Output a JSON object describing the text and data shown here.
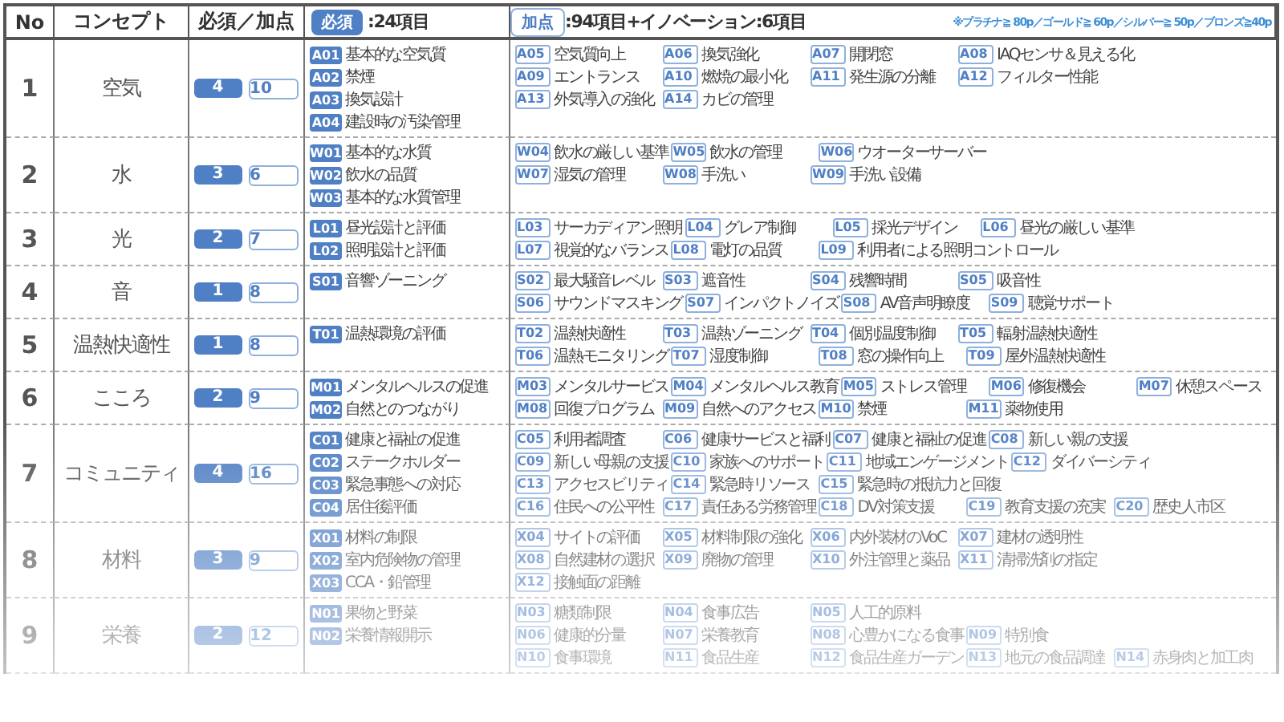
{
  "columns": [
    "No",
    "コンセプト",
    "必須／加点"
  ],
  "required_header": {
    "badge": "必須",
    "text": ":24項目"
  },
  "bonus_header": {
    "badge": "加点",
    "text": ":94項目+イノベーション:6項目",
    "note": "※プラチナ≧ 80p／ゴールド≧ 60p／シルバー≧ 50p／ブロンズ≧40p"
  },
  "rows": [
    {
      "no": "1",
      "concept": "空気",
      "required_count": "4",
      "bonus_count": "10",
      "required": [
        {
          "code": "A01",
          "label": "基本的な空気質"
        },
        {
          "code": "A02",
          "label": "禁煙"
        },
        {
          "code": "A03",
          "label": "換気設計"
        },
        {
          "code": "A04",
          "label": "建設時の汚染管理"
        }
      ],
      "bonus": [
        [
          {
            "code": "A05",
            "label": "空気質向上"
          },
          {
            "code": "A06",
            "label": "換気強化"
          },
          {
            "code": "A07",
            "label": "開閉窓"
          },
          {
            "code": "A08",
            "label": "IAQセンサ＆見える化"
          }
        ],
        [
          {
            "code": "A09",
            "label": "エントランス"
          },
          {
            "code": "A10",
            "label": "燃焼の最小化"
          },
          {
            "code": "A11",
            "label": "発生源の分離"
          },
          {
            "code": "A12",
            "label": "フィルター性能"
          }
        ],
        [
          {
            "code": "A13",
            "label": "外気導入の強化"
          },
          {
            "code": "A14",
            "label": "カビの管理"
          }
        ]
      ]
    },
    {
      "no": "2",
      "concept": "水",
      "required_count": "3",
      "bonus_count": "6",
      "required": [
        {
          "code": "W01",
          "label": "基本的な水質"
        },
        {
          "code": "W02",
          "label": "飲水の品質"
        },
        {
          "code": "W03",
          "label": "基本的な水質管理"
        }
      ],
      "bonus": [
        [
          {
            "code": "W04",
            "label": "飲水の厳しい基準"
          },
          {
            "code": "W05",
            "label": "飲水の管理"
          },
          {
            "code": "W06",
            "label": "ウオーターサーバー"
          }
        ],
        [
          {
            "code": "W07",
            "label": "湿気の管理"
          },
          {
            "code": "W08",
            "label": "手洗い"
          },
          {
            "code": "W09",
            "label": "手洗い設備"
          }
        ]
      ]
    },
    {
      "no": "3",
      "concept": "光",
      "required_count": "2",
      "bonus_count": "7",
      "required": [
        {
          "code": "L01",
          "label": "昼光設計と評価"
        },
        {
          "code": "L02",
          "label": "照明設計と評価"
        }
      ],
      "bonus": [
        [
          {
            "code": "L03",
            "label": "サーカディアン照明"
          },
          {
            "code": "L04",
            "label": "グレア制御"
          },
          {
            "code": "L05",
            "label": "採光デザイン"
          },
          {
            "code": "L06",
            "label": "昼光の厳しい基準"
          }
        ],
        [
          {
            "code": "L07",
            "label": "視覚的なバランス"
          },
          {
            "code": "L08",
            "label": "電灯の品質"
          },
          {
            "code": "L09",
            "label": "利用者による照明コントロール"
          }
        ]
      ]
    },
    {
      "no": "4",
      "concept": "音",
      "required_count": "1",
      "bonus_count": "8",
      "required": [
        {
          "code": "S01",
          "label": "音響ゾーニング"
        }
      ],
      "bonus": [
        [
          {
            "code": "S02",
            "label": "最大騒音レベル"
          },
          {
            "code": "S03",
            "label": "遮音性"
          },
          {
            "code": "S04",
            "label": "残響時間"
          },
          {
            "code": "S05",
            "label": "吸音性"
          }
        ],
        [
          {
            "code": "S06",
            "label": "サウンドマスキング"
          },
          {
            "code": "S07",
            "label": "インパクトノイズ"
          },
          {
            "code": "S08",
            "label": "AV音声明瞭度"
          },
          {
            "code": "S09",
            "label": "聴覚サポート"
          }
        ]
      ]
    },
    {
      "no": "5",
      "concept": "温熱快適性",
      "required_count": "1",
      "bonus_count": "8",
      "required": [
        {
          "code": "T01",
          "label": "温熱環境の評価"
        }
      ],
      "bonus": [
        [
          {
            "code": "T02",
            "label": "温熱快適性"
          },
          {
            "code": "T03",
            "label": "温熱ゾーニング"
          },
          {
            "code": "T04",
            "label": "個別温度制御"
          },
          {
            "code": "T05",
            "label": "輻射温熱快適性"
          }
        ],
        [
          {
            "code": "T06",
            "label": "温熱モニタリング"
          },
          {
            "code": "T07",
            "label": "湿度制御"
          },
          {
            "code": "T08",
            "label": "窓の操作向上"
          },
          {
            "code": "T09",
            "label": "屋外温熱快適性"
          }
        ]
      ]
    },
    {
      "no": "6",
      "concept": "こころ",
      "required_count": "2",
      "bonus_count": "9",
      "required": [
        {
          "code": "M01",
          "label": "メンタルヘルスの促進"
        },
        {
          "code": "M02",
          "label": "自然とのつながり"
        }
      ],
      "bonus": [
        [
          {
            "code": "M03",
            "label": "メンタルサービス"
          },
          {
            "code": "M04",
            "label": "メンタルヘルス教育"
          },
          {
            "code": "M05",
            "label": "ストレス管理"
          },
          {
            "code": "M06",
            "label": "修復機会"
          },
          {
            "code": "M07",
            "label": "休憩スペース"
          }
        ],
        [
          {
            "code": "M08",
            "label": "回復プログラム"
          },
          {
            "code": "M09",
            "label": "自然へのアクセス"
          },
          {
            "code": "M10",
            "label": "禁煙"
          },
          {
            "code": "M11",
            "label": "薬物使用"
          }
        ]
      ]
    },
    {
      "no": "7",
      "concept": "コミュニティ",
      "required_count": "4",
      "bonus_count": "16",
      "required": [
        {
          "code": "C01",
          "label": "健康と福祉の促進"
        },
        {
          "code": "C02",
          "label": "ステークホルダー"
        },
        {
          "code": "C03",
          "label": "緊急事態への対応"
        },
        {
          "code": "C04",
          "label": "居住後評価"
        }
      ],
      "bonus": [
        [
          {
            "code": "C05",
            "label": "利用者調査"
          },
          {
            "code": "C06",
            "label": "健康サービスと福利"
          },
          {
            "code": "C07",
            "label": "健康と福祉の促進"
          },
          {
            "code": "C08",
            "label": "新しい親の支援"
          }
        ],
        [
          {
            "code": "C09",
            "label": "新しい母親の支援"
          },
          {
            "code": "C10",
            "label": "家族へのサポート"
          },
          {
            "code": "C11",
            "label": "地域エンゲージメント"
          },
          {
            "code": "C12",
            "label": "ダイバーシティ"
          }
        ],
        [
          {
            "code": "C13",
            "label": "アクセスビリティ"
          },
          {
            "code": "C14",
            "label": "緊急時リソース"
          },
          {
            "code": "C15",
            "label": "緊急時の抵抗力と回復"
          }
        ],
        [
          {
            "code": "C16",
            "label": "住民への公平性"
          },
          {
            "code": "C17",
            "label": "責任ある労務管理"
          },
          {
            "code": "C18",
            "label": "DV対策支援"
          },
          {
            "code": "C19",
            "label": "教育支援の充実"
          },
          {
            "code": "C20",
            "label": "歴史人市区"
          }
        ]
      ]
    },
    {
      "no": "8",
      "concept": "材料",
      "required_count": "3",
      "bonus_count": "9",
      "required": [
        {
          "code": "X01",
          "label": "材料の制限"
        },
        {
          "code": "X02",
          "label": "室内危険物の管理"
        },
        {
          "code": "X03",
          "label": "CCA・鉛管理"
        }
      ],
      "bonus": [
        [
          {
            "code": "X04",
            "label": "サイトの評価"
          },
          {
            "code": "X05",
            "label": "材料制限の強化"
          },
          {
            "code": "X06",
            "label": "内外装材のVoC"
          },
          {
            "code": "X07",
            "label": "建材の透明性"
          }
        ],
        [
          {
            "code": "X08",
            "label": "自然建材の選択"
          },
          {
            "code": "X09",
            "label": "廃物の管理"
          },
          {
            "code": "X10",
            "label": "外注管理と薬品"
          },
          {
            "code": "X11",
            "label": "清掃洗剤の指定"
          }
        ],
        [
          {
            "code": "X12",
            "label": "接触面の距離"
          }
        ]
      ]
    },
    {
      "no": "9",
      "concept": "栄養",
      "required_count": "2",
      "bonus_count": "12",
      "required": [
        {
          "code": "N01",
          "label": "果物と野菜"
        },
        {
          "code": "N02",
          "label": "栄養情報開示"
        }
      ],
      "bonus": [
        [
          {
            "code": "N03",
            "label": "糖類制限"
          },
          {
            "code": "N04",
            "label": "食事広告"
          },
          {
            "code": "N05",
            "label": "人工的原料"
          }
        ],
        [
          {
            "code": "N06",
            "label": "健康的分量"
          },
          {
            "code": "N07",
            "label": "栄養教育"
          },
          {
            "code": "N08",
            "label": "心豊かになる食事"
          },
          {
            "code": "N09",
            "label": "特別食"
          }
        ],
        [
          {
            "code": "N10",
            "label": "食事環境"
          },
          {
            "code": "N11",
            "label": "食品生産"
          },
          {
            "code": "N12",
            "label": "食品生産ガーデン"
          },
          {
            "code": "N13",
            "label": "地元の食品調達"
          },
          {
            "code": "N14",
            "label": "赤身肉と加工肉"
          }
        ]
      ]
    }
  ]
}
